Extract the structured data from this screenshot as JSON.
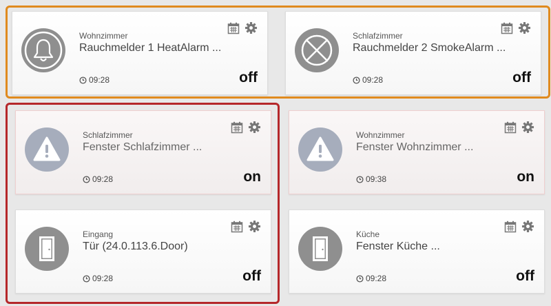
{
  "colors": {
    "orange_group": "#e08a1e",
    "red_group": "#b5272a",
    "icon_dark": "#8f8f8f",
    "icon_blue": "#a6adbc"
  },
  "devices": [
    {
      "room": "Wohnzimmer",
      "title": "Rauchmelder 1 HeatAlarm ...",
      "time": "09:28",
      "state": "off",
      "icon": "bell-icon"
    },
    {
      "room": "Schlafzimmer",
      "title": "Rauchmelder 2 SmokeAlarm ...",
      "time": "09:28",
      "state": "off",
      "icon": "smoke-detector-x-icon"
    },
    {
      "room": "Schlafzimmer",
      "title": "Fenster Schlafzimmer ...",
      "time": "09:28",
      "state": "on",
      "icon": "warning-icon"
    },
    {
      "room": "Wohnzimmer",
      "title": "Fenster Wohnzimmer ...",
      "time": "09:38",
      "state": "on",
      "icon": "warning-icon"
    },
    {
      "room": "Eingang",
      "title": "Tür (24.0.113.6.Door)",
      "time": "09:28",
      "state": "off",
      "icon": "door-icon"
    },
    {
      "room": "Küche",
      "title": "Fenster Küche ...",
      "time": "09:28",
      "state": "off",
      "icon": "door-icon"
    }
  ]
}
